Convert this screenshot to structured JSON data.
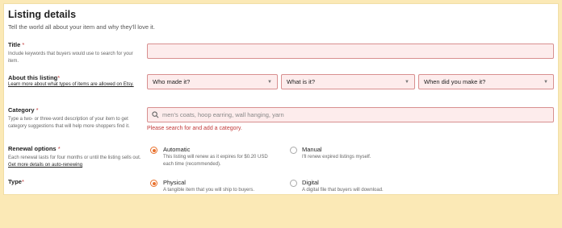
{
  "header": {
    "title": "Listing details",
    "subtitle": "Tell the world all about your item and why they'll love it."
  },
  "title_field": {
    "label": "Title",
    "required_mark": "*",
    "description": "Include keywords that buyers would use to search for your item.",
    "value": ""
  },
  "about": {
    "label": "About this listing",
    "required_mark": "*",
    "link_text": "Learn more about what types of items are allowed on Etsy.",
    "who_made": "Who made it?",
    "what_is": "What is it?",
    "when_made": "When did you make it?"
  },
  "category": {
    "label": "Category",
    "required_mark": "*",
    "description": "Type a two- or three-word description of your item to get category suggestions that will help more shoppers find it.",
    "placeholder": "men's coats, hoop earring, wall hanging, yarn",
    "error": "Please search for and add a category."
  },
  "renewal": {
    "label": "Renewal options",
    "required_mark": "*",
    "description": "Each renewal lasts for four months or until the listing sells out.",
    "link_text": "Get more details on auto-renewing",
    "option1_title": "Automatic",
    "option1_desc": "This listing will renew as it expires for $0.20 USD each time (recommended).",
    "option2_title": "Manual",
    "option2_desc": "I'll renew expired listings myself.",
    "selected": "Automatic"
  },
  "type": {
    "label": "Type",
    "required_mark": "*",
    "option1_title": "Physical",
    "option1_desc": "A tangible item that you will ship to buyers.",
    "option2_title": "Digital",
    "option2_desc": "A digital file that buyers will download.",
    "selected": "Physical"
  },
  "colors": {
    "accent": "#e8712d",
    "error": "#c23a3a",
    "frame": "#fbe9b6"
  },
  "icons": {
    "search": "search-icon",
    "caret": "chevron-down-icon"
  }
}
